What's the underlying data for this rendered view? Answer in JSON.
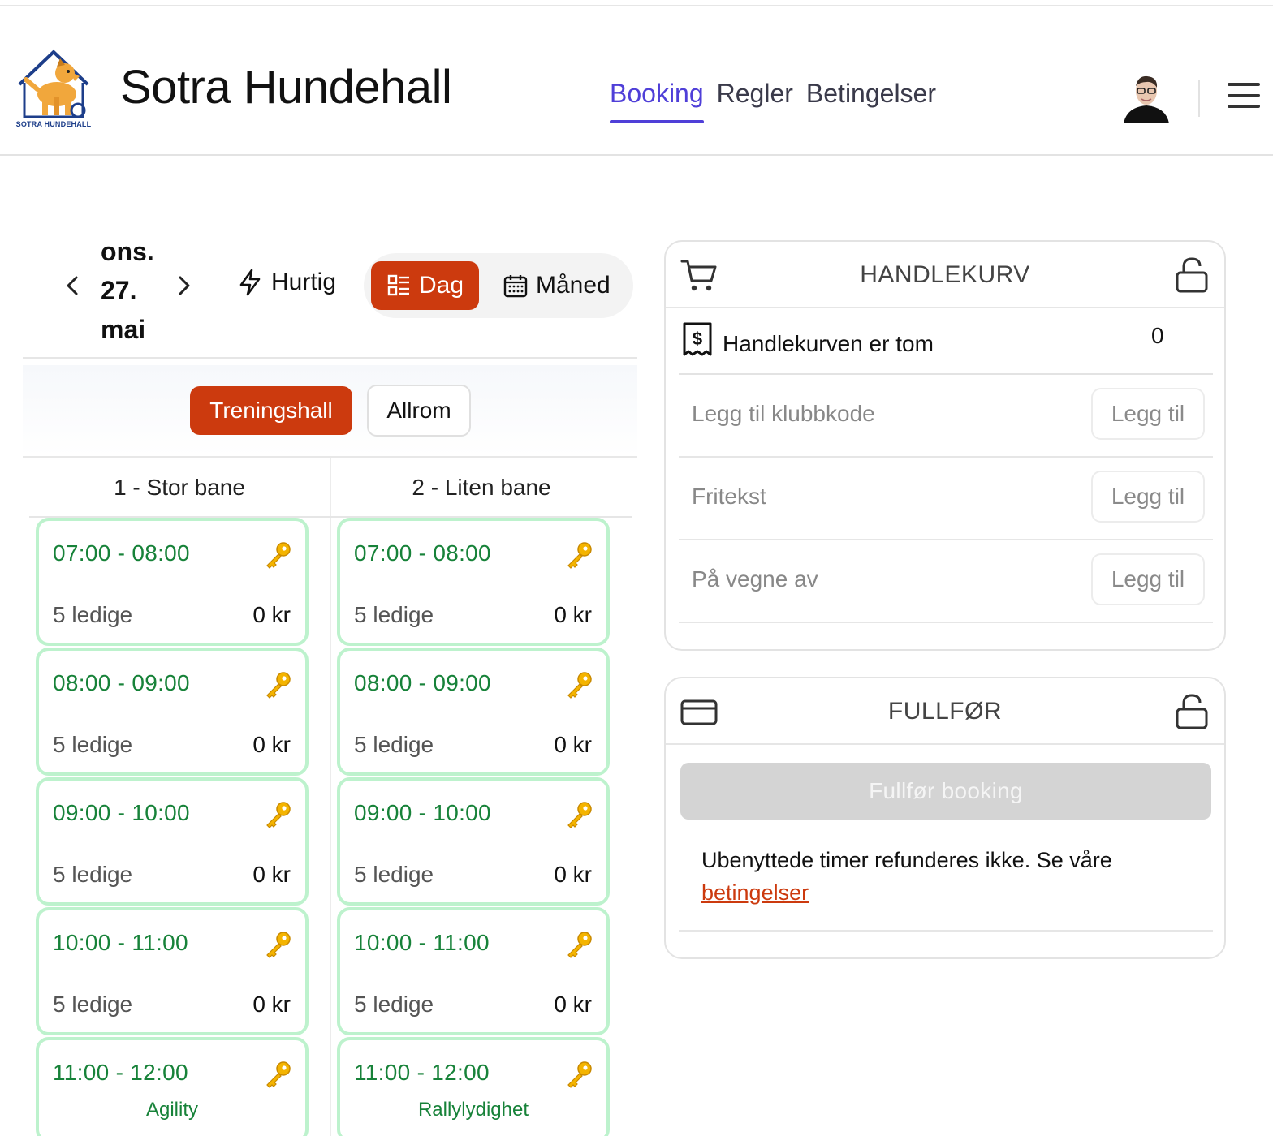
{
  "header": {
    "logo_text": "SOTRA HUNDEHALL",
    "brand": "Sotra Hundehall",
    "nav": [
      {
        "label": "Booking",
        "active": true
      },
      {
        "label": "Regler",
        "active": false
      },
      {
        "label": "Betingelser",
        "active": false
      }
    ]
  },
  "calendar": {
    "date_lines": [
      "ons.",
      "27.",
      "mai"
    ],
    "views": {
      "quick": "Hurtig",
      "day": "Dag",
      "month": "Måned"
    },
    "rooms": [
      {
        "label": "Treningshall",
        "active": true
      },
      {
        "label": "Allrom",
        "active": false
      }
    ],
    "columns": [
      {
        "title": "1 - Stor bane",
        "slots": [
          {
            "time": "07:00 - 08:00",
            "available": "5 ledige",
            "price": "0 kr"
          },
          {
            "time": "08:00 - 09:00",
            "available": "5 ledige",
            "price": "0 kr"
          },
          {
            "time": "09:00 - 10:00",
            "available": "5 ledige",
            "price": "0 kr"
          },
          {
            "time": "10:00 - 11:00",
            "available": "5 ledige",
            "price": "0 kr"
          },
          {
            "time": "11:00 - 12:00",
            "activity": "Agility"
          }
        ]
      },
      {
        "title": "2 - Liten bane",
        "slots": [
          {
            "time": "07:00 - 08:00",
            "available": "5 ledige",
            "price": "0 kr"
          },
          {
            "time": "08:00 - 09:00",
            "available": "5 ledige",
            "price": "0 kr"
          },
          {
            "time": "09:00 - 10:00",
            "available": "5 ledige",
            "price": "0 kr"
          },
          {
            "time": "10:00 - 11:00",
            "available": "5 ledige",
            "price": "0 kr"
          },
          {
            "time": "11:00 - 12:00",
            "activity": "Rallylydighet"
          }
        ]
      }
    ]
  },
  "cart": {
    "title": "HANDLEKURV",
    "empty_text": "Handlekurven er tom",
    "count": "0",
    "inputs": [
      {
        "placeholder": "Legg til klubbkode",
        "button": "Legg til"
      },
      {
        "placeholder": "Fritekst",
        "button": "Legg til"
      },
      {
        "placeholder": "På vegne av",
        "button": "Legg til"
      }
    ]
  },
  "finish": {
    "title": "FULLFØR",
    "button": "Fullfør booking",
    "terms_text": "Ubenyttede timer refunderes ikke. Se våre",
    "terms_link": "betingelser"
  },
  "colors": {
    "accent": "#cc3a0e",
    "nav_active": "#4f3fd8",
    "slot_text": "#178239",
    "slot_border": "#bdf2cd"
  },
  "icons": [
    "logo-dog-house",
    "avatar",
    "hamburger-icon",
    "chevron-left-icon",
    "chevron-right-icon",
    "lightning-icon",
    "list-icon",
    "calendar-icon",
    "key-icon",
    "cart-icon",
    "unlock-icon",
    "receipt-dollar-icon",
    "credit-card-icon"
  ]
}
